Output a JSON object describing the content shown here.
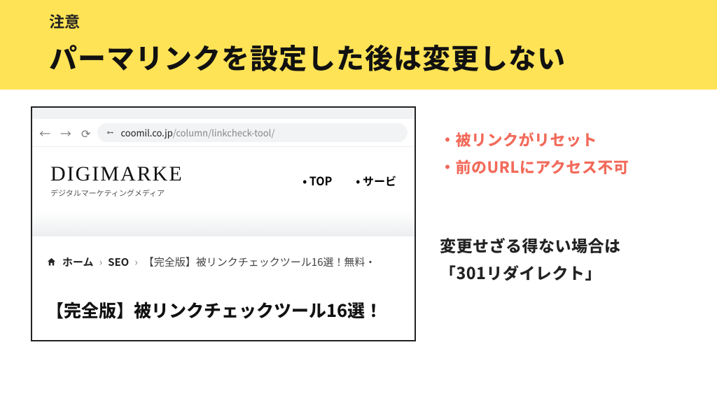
{
  "banner": {
    "label": "注意",
    "headline": "パーマリンクを設定した後は変更しない"
  },
  "screenshot": {
    "url_domain": "coomil.co.jp",
    "url_path": "/column/linkcheck-tool/",
    "brand": "DIGIMARKE",
    "tagline": "デジタルマーケティングメディア",
    "nav": {
      "item1": "TOP",
      "item2": "サービ"
    },
    "breadcrumb": {
      "home": "ホーム",
      "cat": "SEO",
      "page": "【完全版】被リンクチェックツール16選！無料・"
    },
    "article_title": "【完全版】被リンクチェックツール16選！"
  },
  "side": {
    "bullet1": "・被リンクがリセット",
    "bullet2": "・前のURLにアクセス不可",
    "note_line1": "変更せざる得ない場合は",
    "note_line2": "「301リダイレクト」"
  }
}
